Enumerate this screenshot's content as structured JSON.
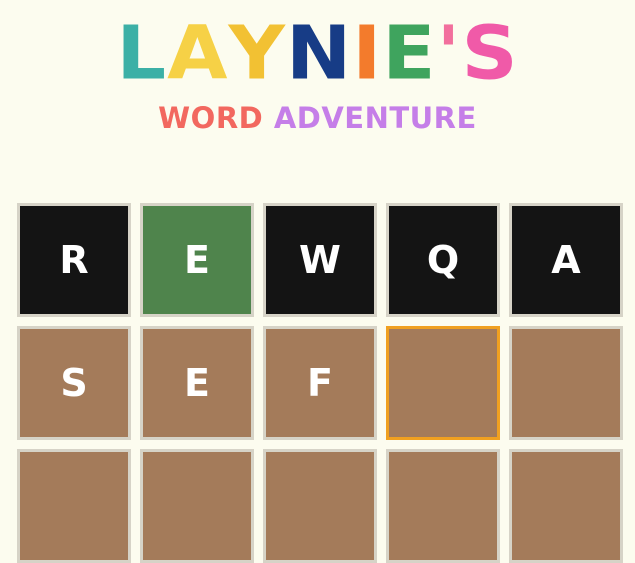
{
  "logo": {
    "title_letters": [
      {
        "char": "L",
        "color": "#3cb0a6"
      },
      {
        "char": "A",
        "color": "#f6d146"
      },
      {
        "char": "Y",
        "color": "#f2c133"
      },
      {
        "char": "N",
        "color": "#173c86"
      },
      {
        "char": "I",
        "color": "#f37b2c"
      },
      {
        "char": "E",
        "color": "#3fa45e"
      },
      {
        "char": "'",
        "color": "#f26f9d"
      },
      {
        "char": "S",
        "color": "#f05aa8"
      }
    ],
    "subtitle_parts": [
      {
        "text": "WORD ",
        "color": "#f2685f"
      },
      {
        "text": "ADVENTURE",
        "color": "#c57ee8"
      }
    ]
  },
  "board": {
    "rows": [
      [
        {
          "letter": "R",
          "state": "absent"
        },
        {
          "letter": "E",
          "state": "correct"
        },
        {
          "letter": "W",
          "state": "absent"
        },
        {
          "letter": "Q",
          "state": "absent"
        },
        {
          "letter": "A",
          "state": "absent"
        }
      ],
      [
        {
          "letter": "S",
          "state": "empty"
        },
        {
          "letter": "E",
          "state": "empty"
        },
        {
          "letter": "F",
          "state": "empty"
        },
        {
          "letter": "",
          "state": "empty",
          "active": true
        },
        {
          "letter": "",
          "state": "empty"
        }
      ],
      [
        {
          "letter": "",
          "state": "empty"
        },
        {
          "letter": "",
          "state": "empty"
        },
        {
          "letter": "",
          "state": "empty"
        },
        {
          "letter": "",
          "state": "empty"
        },
        {
          "letter": "",
          "state": "empty"
        }
      ]
    ]
  },
  "colors": {
    "background": "#fcfcef",
    "absent": "#141414",
    "correct": "#4f844c",
    "empty": "#a47b5a",
    "active_border": "#f0a020",
    "tile_border": "#d6d3c7"
  }
}
